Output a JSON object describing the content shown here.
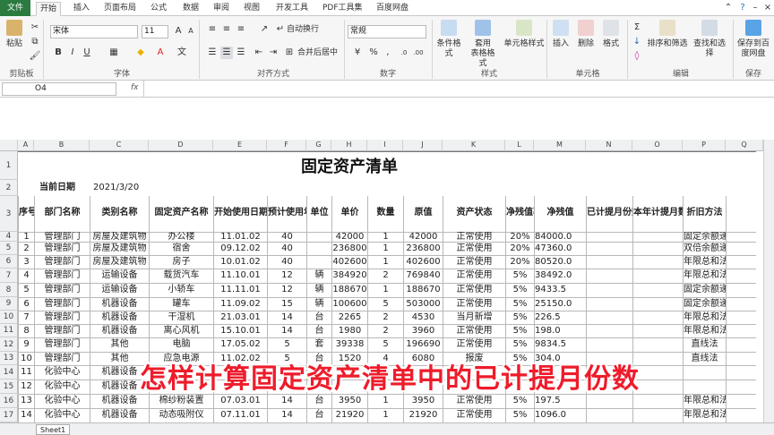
{
  "tabs": [
    "文件",
    "开始",
    "插入",
    "页面布局",
    "公式",
    "数据",
    "审阅",
    "视图",
    "开发工具",
    "PDF工具集",
    "百度网盘"
  ],
  "ribbon": {
    "paste": "粘贴",
    "font_name": "宋体",
    "font_size": "11",
    "wrap_text": "自动换行",
    "merge_center": "合并后居中",
    "number_format": "常规",
    "conditional_format": "条件格式",
    "table_format_1": "套用",
    "table_format_2": "表格格式",
    "cell_style": "单元格样式",
    "insert": "插入",
    "delete": "删除",
    "format": "格式",
    "sort_filter": "排序和筛选",
    "find_select": "查找和选择",
    "save_baidu_1": "保存到百",
    "save_baidu_2": "度网盘",
    "groups": {
      "clipboard": "剪贴板",
      "font": "字体",
      "alignment": "对齐方式",
      "number": "数字",
      "styles": "样式",
      "cells": "单元格",
      "editing": "编辑",
      "save": "保存"
    }
  },
  "formula_bar": {
    "name_box": "O4",
    "fx": "fx"
  },
  "columns": [
    "A",
    "B",
    "C",
    "D",
    "E",
    "F",
    "G",
    "H",
    "I",
    "J",
    "K",
    "L",
    "M",
    "N",
    "O",
    "P",
    "Q"
  ],
  "sheet": {
    "title": "固定资产清单",
    "date_label": "当前日期",
    "date_value": "2021/3/20",
    "headers": [
      "序号",
      "部门名称",
      "类别名称",
      "固定资产名称",
      "开始使用日期",
      "预计使用年限",
      "单位",
      "单价",
      "数量",
      "原值",
      "资产状态",
      "净残值率",
      "净残值",
      "已计提月份数",
      "本年计提月数",
      "折旧方法"
    ],
    "rows": [
      [
        "1",
        "管理部门",
        "房屋及建筑物",
        "办公楼",
        "11.01.02",
        "40",
        "",
        "42000",
        "1",
        "42000",
        "正常使用",
        "20%",
        "84000.0",
        "",
        "",
        "固定余额递减法"
      ],
      [
        "2",
        "管理部门",
        "房屋及建筑物",
        "宿舍",
        "09.12.02",
        "40",
        "",
        "236800",
        "1",
        "236800",
        "正常使用",
        "20%",
        "47360.0",
        "",
        "",
        "双倍余额递减法"
      ],
      [
        "3",
        "管理部门",
        "房屋及建筑物",
        "房子",
        "10.01.02",
        "40",
        "",
        "402600",
        "1",
        "402600",
        "正常使用",
        "20%",
        "80520.0",
        "",
        "",
        "年限总和法"
      ],
      [
        "4",
        "管理部门",
        "运输设备",
        "载货汽车",
        "11.10.01",
        "12",
        "辆",
        "384920",
        "2",
        "769840",
        "正常使用",
        "5%",
        "38492.0",
        "",
        "",
        "年限总和法"
      ],
      [
        "5",
        "管理部门",
        "运输设备",
        "小轿车",
        "11.11.01",
        "12",
        "辆",
        "188670",
        "1",
        "188670",
        "正常使用",
        "5%",
        "9433.5",
        "",
        "",
        "固定余额递减法"
      ],
      [
        "6",
        "管理部门",
        "机器设备",
        "罐车",
        "11.09.02",
        "15",
        "辆",
        "100600",
        "5",
        "503000",
        "正常使用",
        "5%",
        "25150.0",
        "",
        "",
        "固定余额递减法"
      ],
      [
        "7",
        "管理部门",
        "机器设备",
        "干湿机",
        "21.03.01",
        "14",
        "台",
        "2265",
        "2",
        "4530",
        "当月新增",
        "5%",
        "226.5",
        "",
        "",
        "年限总和法"
      ],
      [
        "8",
        "管理部门",
        "机器设备",
        "离心风机",
        "15.10.01",
        "14",
        "台",
        "1980",
        "2",
        "3960",
        "正常使用",
        "5%",
        "198.0",
        "",
        "",
        "年限总和法"
      ],
      [
        "9",
        "管理部门",
        "其他",
        "电脑",
        "17.05.02",
        "5",
        "套",
        "39338",
        "5",
        "196690",
        "正常使用",
        "5%",
        "9834.5",
        "",
        "",
        "直线法"
      ],
      [
        "10",
        "管理部门",
        "其他",
        "应急电源",
        "11.02.02",
        "5",
        "台",
        "1520",
        "4",
        "6080",
        "报废",
        "5%",
        "304.0",
        "",
        "",
        "直线法"
      ],
      [
        "11",
        "化验中心",
        "机器设备",
        "",
        "",
        "",
        "",
        "",
        "",
        "",
        "",
        "",
        "",
        "",
        "",
        ""
      ],
      [
        "12",
        "化验中心",
        "机器设备",
        "",
        "",
        "",
        "",
        "",
        "",
        "",
        "",
        "",
        "",
        "",
        "",
        ""
      ],
      [
        "13",
        "化验中心",
        "机器设备",
        "棉纱粉装置",
        "07.03.01",
        "14",
        "台",
        "3950",
        "1",
        "3950",
        "正常使用",
        "5%",
        "197.5",
        "",
        "",
        "年限总和法"
      ],
      [
        "14",
        "化验中心",
        "机器设备",
        "动态吸附仪",
        "07.11.01",
        "14",
        "台",
        "21920",
        "1",
        "21920",
        "正常使用",
        "5%",
        "1096.0",
        "",
        "",
        "年限总和法"
      ]
    ],
    "row_numbers": [
      "1",
      "2",
      "3",
      "4",
      "5",
      "6",
      "7",
      "8",
      "9",
      "10",
      "11",
      "12",
      "13",
      "14",
      "15",
      "16",
      "17"
    ]
  },
  "overlay_caption": "怎样计算固定资产清单中的已计提月份数",
  "sheet_tab": "Sheet1",
  "colors": {
    "file_tab": "#2b7a3f",
    "overlay": "#ee1c2b"
  }
}
